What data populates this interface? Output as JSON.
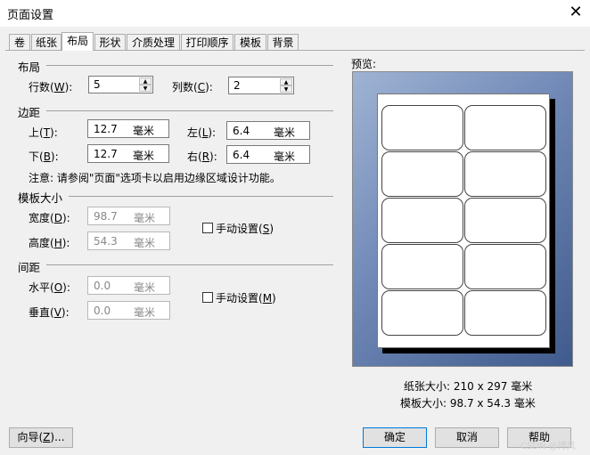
{
  "window": {
    "title": "页面设置",
    "close_glyph": "✕"
  },
  "tabs": [
    "卷",
    "纸张",
    "布局",
    "形状",
    "介质处理",
    "打印顺序",
    "模板",
    "背景"
  ],
  "active_tab": "布局",
  "layout": {
    "heading": "布局",
    "rows_label": "行数(",
    "rows_key": "W",
    "rows_value": "5",
    "cols_label": "列数(",
    "cols_key": "C",
    "cols_value": "2"
  },
  "margins": {
    "heading": "边距",
    "top": {
      "label": "上(",
      "key": "T",
      "value": "12.7",
      "unit": "毫米"
    },
    "left": {
      "label": "左(",
      "key": "L",
      "value": "6.4",
      "unit": "毫米"
    },
    "bottom": {
      "label": "下(",
      "key": "B",
      "value": "12.7",
      "unit": "毫米"
    },
    "right": {
      "label": "右(",
      "key": "R",
      "value": "6.4",
      "unit": "毫米"
    },
    "note": "注意: 请参阅\"页面\"选项卡以启用边缘区域设计功能。"
  },
  "template_size": {
    "heading": "模板大小",
    "width": {
      "label": "宽度(",
      "key": "D",
      "value": "98.7",
      "unit": "毫米"
    },
    "height": {
      "label": "高度(",
      "key": "H",
      "value": "54.3",
      "unit": "毫米"
    },
    "manual": {
      "label": "手动设置(",
      "key": "S",
      "checked": false
    }
  },
  "spacing": {
    "heading": "间距",
    "horizontal": {
      "label": "水平(",
      "key": "O",
      "value": "0.0",
      "unit": "毫米"
    },
    "vertical": {
      "label": "垂直(",
      "key": "V",
      "value": "0.0",
      "unit": "毫米"
    },
    "manual": {
      "label": "手动设置(",
      "key": "M",
      "checked": false
    }
  },
  "preview": {
    "label": "预览:",
    "paper_size": "纸张大小:  210 x 297 毫米",
    "template_size": "模板大小:  98.7 x 54.3 毫米"
  },
  "buttons": {
    "wizard_label": "向导(",
    "wizard_key": "Z",
    "wizard_suffix": ")...",
    "ok": "确定",
    "cancel": "取消",
    "help": "帮助"
  },
  "watermark": "CSDN @博风",
  "colors": {
    "preview_bg_light": "#9fb3d3",
    "preview_bg_dark": "#3f5a8c",
    "default_button_border": "#0078d7"
  }
}
